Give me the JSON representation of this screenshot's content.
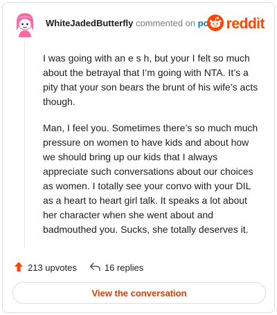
{
  "header": {
    "username": "WhiteJadedButterfly",
    "commented_text": "commented on",
    "post_link": "post",
    "brand": "reddit"
  },
  "comment": {
    "paragraphs": [
      "I was going with an e s h, but your I felt so much about the betrayal that I’m going with NTA. It’s a pity that your son bears the brunt of his wife’s acts though.",
      "Man, I feel you. Sometimes there’s so much much pressure on women to have kids and about how we should bring up our kids that I always appreciate such conversations about our choices as women. I totally see your convo with your DIL as a heart to heart girl talk. It speaks a lot about her character when she went about and badmouthed you. Sucks, she totally deserves it."
    ]
  },
  "actions": {
    "upvotes": "213 upvotes",
    "replies": "16 replies"
  },
  "cta": {
    "label": "View the conversation"
  },
  "colors": {
    "brand": "#ff4500",
    "upvote": "#ff4500",
    "link": "#0079d3",
    "cta_text": "#d93a00"
  },
  "icons": {
    "avatar": "snoo-avatar-pink",
    "brand": "reddit-snoo-icon",
    "upvote": "upvote-arrow-icon",
    "reply": "reply-arrow-icon"
  }
}
